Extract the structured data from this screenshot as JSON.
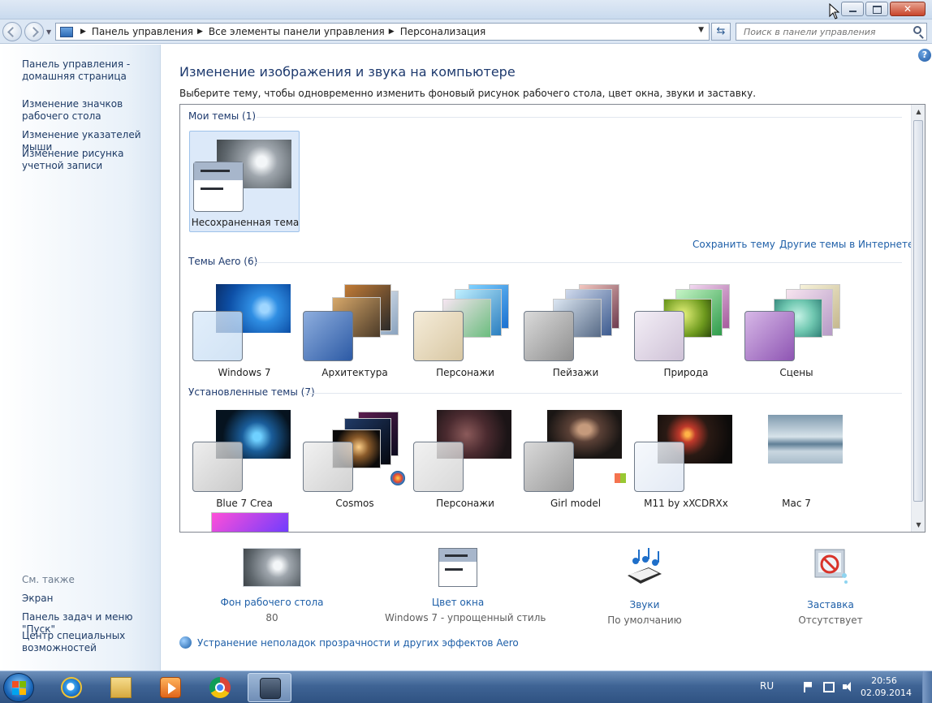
{
  "breadcrumb": [
    "Панель управления",
    "Все элементы панели управления",
    "Персонализация"
  ],
  "search": {
    "placeholder": "Поиск в панели управления"
  },
  "left_nav": {
    "links": [
      "Панель управления - домашняя страница",
      "Изменение значков рабочего стола",
      "Изменение указателей мыши",
      "Изменение рисунка учетной записи"
    ],
    "see_also_title": "См. также",
    "see_also": [
      "Экран",
      "Панель задач и меню \"Пуск\"",
      "Центр специальных возможностей"
    ]
  },
  "main": {
    "title": "Изменение изображения и звука на компьютере",
    "description": "Выберите тему, чтобы одновременно изменить фоновый рисунок рабочего стола, цвет окна, звуки и заставку.",
    "save_theme": "Сохранить тему",
    "more_themes": "Другие темы в Интернете",
    "groups": [
      {
        "header": "Мои темы (1)",
        "themes": [
          "Несохраненная тема"
        ]
      },
      {
        "header": "Темы Aero (6)",
        "themes": [
          "Windows 7",
          "Архитектура",
          "Персонажи",
          "Пейзажи",
          "Природа",
          "Сцены"
        ]
      },
      {
        "header": "Установленные темы (7)",
        "themes": [
          "Blue 7 Crea",
          "Cosmos",
          "Персонажи",
          "Girl model",
          "M11 by xXCDRXx",
          "Mac 7"
        ]
      }
    ],
    "selected_theme": "Несохраненная тема"
  },
  "bottom": {
    "items": [
      {
        "label": "Фон рабочего стола",
        "value": "80",
        "icon": "wallpaper-icon"
      },
      {
        "label": "Цвет окна",
        "value": "Windows 7 - упрощенный стиль",
        "icon": "window-color-icon"
      },
      {
        "label": "Звуки",
        "value": "По умолчанию",
        "icon": "sounds-icon"
      },
      {
        "label": "Заставка",
        "value": "Отсутствует",
        "icon": "screensaver-icon"
      }
    ],
    "troubleshoot": "Устранение неполадок прозрачности и других эффектов Aero"
  },
  "taskbar": {
    "language": "RU",
    "time": "20:56",
    "date": "02.09.2014",
    "pinned": [
      "internet-explorer-icon",
      "explorer-folder-icon",
      "media-player-icon",
      "chrome-icon",
      "control-panel-window-icon"
    ]
  },
  "colors": {
    "link": "#1e5fa8",
    "heading": "#1e3a6e",
    "selection": "#dce9f9",
    "taskbar": "#3f6495"
  }
}
